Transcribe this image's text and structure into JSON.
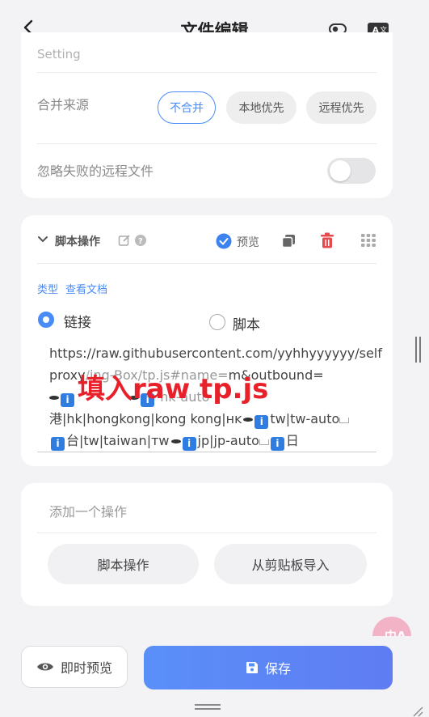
{
  "header": {
    "title": "文件编辑"
  },
  "merge_card": {
    "partial_label": "Setting",
    "merge_source_label": "合并来源",
    "merge_options": [
      "不合并",
      "本地优先",
      "远程优先"
    ],
    "selected_option": "不合并",
    "ignore_label": "忽略失败的远程文件",
    "ignore_enabled": false
  },
  "script_card": {
    "title": "脚本操作",
    "preview_label": "预览",
    "type_label": "类型",
    "docs_link": "查看文档",
    "type_options": [
      "链接",
      "脚本"
    ],
    "selected_type": "链接",
    "url_lines": [
      "https://raw.githubusercontent.com/yyhhyyyyyy/self",
      "proxy",
      "港|hk|hongkong|kong kong|ʜᴋ",
      "tw|tw-auto",
      "台|tw|taiwan|ᴛᴡ",
      "jp|jp-auto",
      "日"
    ],
    "url_partial_1": "ing-Box/tp.js#name=",
    "url_partial_2": "m&outbound=",
    "url_partial_3": "hk-auto"
  },
  "add_card": {
    "title": "添加一个操作",
    "buttons": [
      "脚本操作",
      "从剪贴板导入"
    ]
  },
  "overlay_annotation": "填入raw tp.js",
  "translate_icon_text": "中A",
  "footer": {
    "preview_button": "即时预览",
    "save_button": "保存"
  },
  "colors": {
    "accent": "#4a8cf7",
    "danger": "#e5484d",
    "annotation": "#e8202a"
  }
}
